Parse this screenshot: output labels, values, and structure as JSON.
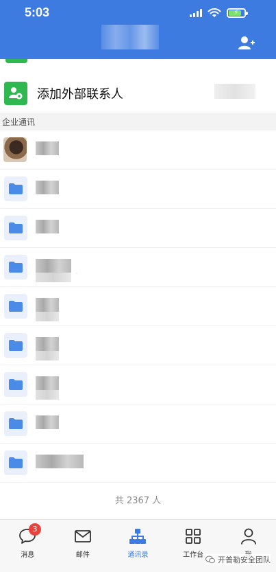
{
  "status_bar": {
    "time": "5:03"
  },
  "content": {
    "add_external_contact": "添加外部联系人",
    "section_label": "企业通讯",
    "total_count": "共 2367 人",
    "items": [
      {
        "kind": "avatar"
      },
      {
        "kind": "folder"
      },
      {
        "kind": "folder"
      },
      {
        "kind": "folder"
      },
      {
        "kind": "folder"
      },
      {
        "kind": "folder"
      },
      {
        "kind": "folder"
      },
      {
        "kind": "folder"
      },
      {
        "kind": "folder"
      }
    ]
  },
  "tabbar": {
    "tabs": [
      {
        "label": "消息",
        "icon": "chat-bubble-icon"
      },
      {
        "label": "邮件",
        "icon": "mail-icon"
      },
      {
        "label": "通讯录",
        "icon": "org-chart-icon",
        "active": true
      },
      {
        "label": "工作台",
        "icon": "grid-icon"
      },
      {
        "label": "我",
        "icon": "person-icon"
      }
    ],
    "message_badge": "3"
  },
  "watermark_brand": "开普勒安全团队",
  "colors": {
    "header": "#3d7be0",
    "accent_green": "#2fb84f",
    "active_tab": "#3d7be0",
    "badge": "#e8423c"
  }
}
